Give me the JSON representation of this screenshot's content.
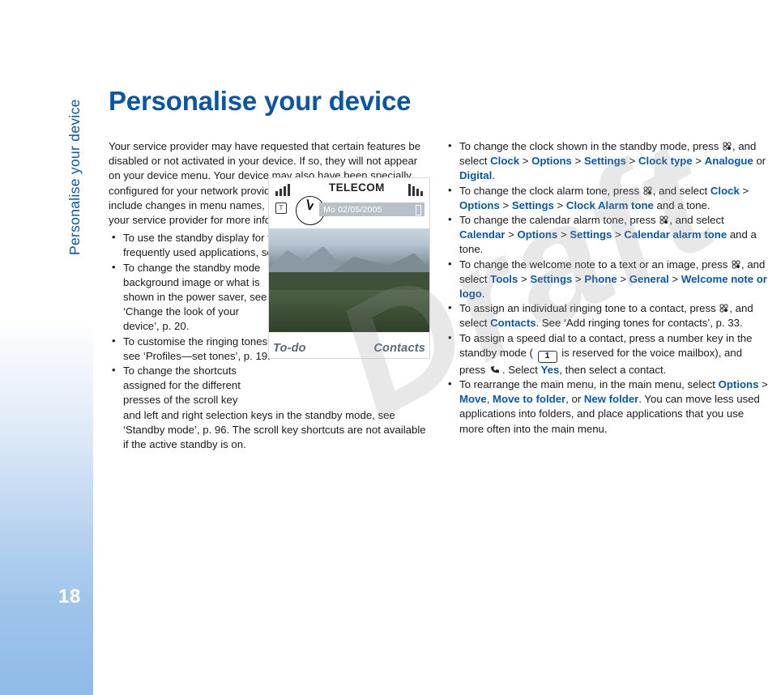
{
  "sidebar": {
    "running_head": "Personalise your device",
    "page_number": "18"
  },
  "page": {
    "title": "Personalise your device",
    "watermark": "Draft"
  },
  "left_column": {
    "intro": "Your service provider may have requested that certain features be disabled or not activated in your device. If so, they will not appear on your device menu. Your device may also have been specially configured for your network provider. This configuration may include changes in menu names, menu order, and icons. Contact your service provider for more information.",
    "bullets": [
      "To use the standby display for fast access to your most frequently used applications, see ‘Active standby mode’, p. 21.",
      "To change the standby mode background image or what is shown in the power saver, see ‘Change the look of your device’, p. 20.",
      "To customise the ringing tones, see ‘Profiles—set tones’, p. 19.",
      "To change the shortcuts assigned for the different presses of the scroll key and left and right selection keys in the standby mode, see ‘Standby mode’, p. 96. The scroll key shortcuts are not available if the active standby is on."
    ]
  },
  "phone_figure": {
    "operator": "TELECOM",
    "date": "Mo 02/05/2005",
    "softkey_left": "To-do",
    "softkey_right": "Contacts"
  },
  "right_column": {
    "bullets": [
      {
        "parts": [
          {
            "t": "To change the clock shown in the standby mode, press ",
            "s": "plain"
          },
          {
            "t": "menu-icon",
            "s": "icon"
          },
          {
            "t": ", and select ",
            "s": "plain"
          },
          {
            "t": "Clock",
            "s": "blue"
          },
          {
            "t": " > ",
            "s": "plain"
          },
          {
            "t": "Options",
            "s": "blue"
          },
          {
            "t": " > ",
            "s": "plain"
          },
          {
            "t": "Settings",
            "s": "blue"
          },
          {
            "t": " > ",
            "s": "plain"
          },
          {
            "t": "Clock type",
            "s": "blue"
          },
          {
            "t": " > ",
            "s": "plain"
          },
          {
            "t": "Analogue",
            "s": "blue"
          },
          {
            "t": " or ",
            "s": "plain"
          },
          {
            "t": "Digital",
            "s": "blue"
          },
          {
            "t": ".",
            "s": "plain"
          }
        ]
      },
      {
        "parts": [
          {
            "t": "To change the clock alarm tone, press ",
            "s": "plain"
          },
          {
            "t": "menu-icon",
            "s": "icon"
          },
          {
            "t": ", and select ",
            "s": "plain"
          },
          {
            "t": "Clock",
            "s": "blue"
          },
          {
            "t": " > ",
            "s": "plain"
          },
          {
            "t": "Options",
            "s": "blue"
          },
          {
            "t": " > ",
            "s": "plain"
          },
          {
            "t": "Settings",
            "s": "blue"
          },
          {
            "t": " > ",
            "s": "plain"
          },
          {
            "t": "Clock Alarm tone",
            "s": "blue"
          },
          {
            "t": " and a tone.",
            "s": "plain"
          }
        ]
      },
      {
        "parts": [
          {
            "t": "To change the calendar alarm tone, press ",
            "s": "plain"
          },
          {
            "t": "menu-icon",
            "s": "icon"
          },
          {
            "t": ", and select ",
            "s": "plain"
          },
          {
            "t": "Calendar",
            "s": "blue"
          },
          {
            "t": " > ",
            "s": "plain"
          },
          {
            "t": "Options",
            "s": "blue"
          },
          {
            "t": " > ",
            "s": "plain"
          },
          {
            "t": "Settings",
            "s": "blue"
          },
          {
            "t": " > ",
            "s": "plain"
          },
          {
            "t": "Calendar alarm tone",
            "s": "blue"
          },
          {
            "t": " and a tone.",
            "s": "plain"
          }
        ]
      },
      {
        "parts": [
          {
            "t": "To change the welcome note to a text or an image, press ",
            "s": "plain"
          },
          {
            "t": "menu-icon",
            "s": "icon"
          },
          {
            "t": ", and select ",
            "s": "plain"
          },
          {
            "t": "Tools",
            "s": "blue"
          },
          {
            "t": " > ",
            "s": "plain"
          },
          {
            "t": "Settings",
            "s": "blue"
          },
          {
            "t": " > ",
            "s": "plain"
          },
          {
            "t": "Phone",
            "s": "blue"
          },
          {
            "t": " > ",
            "s": "plain"
          },
          {
            "t": "General",
            "s": "blue"
          },
          {
            "t": " > ",
            "s": "plain"
          },
          {
            "t": "Welcome note or logo",
            "s": "blue"
          },
          {
            "t": ".",
            "s": "plain"
          }
        ]
      },
      {
        "parts": [
          {
            "t": "To assign an individual ringing tone to a contact, press ",
            "s": "plain"
          },
          {
            "t": "menu-icon",
            "s": "icon"
          },
          {
            "t": ", and select ",
            "s": "plain"
          },
          {
            "t": "Contacts",
            "s": "blue"
          },
          {
            "t": ". See ‘Add ringing tones for contacts’, p. 33.",
            "s": "plain"
          }
        ]
      },
      {
        "parts": [
          {
            "t": "To assign a speed dial to a contact, press a number key in the standby mode ( ",
            "s": "plain"
          },
          {
            "t": "key-1-icon",
            "s": "key"
          },
          {
            "t": " is reserved for the voice mailbox), and press ",
            "s": "plain"
          },
          {
            "t": "call-key-icon",
            "s": "callkey"
          },
          {
            "t": ". Select ",
            "s": "plain"
          },
          {
            "t": "Yes",
            "s": "blue"
          },
          {
            "t": ", then select a contact.",
            "s": "plain"
          }
        ]
      },
      {
        "parts": [
          {
            "t": "To rearrange the main menu, in the main menu, select ",
            "s": "plain"
          },
          {
            "t": "Options",
            "s": "blue"
          },
          {
            "t": " > ",
            "s": "plain"
          },
          {
            "t": "Move",
            "s": "blue"
          },
          {
            "t": ", ",
            "s": "plain"
          },
          {
            "t": "Move to folder",
            "s": "blue"
          },
          {
            "t": ", or ",
            "s": "plain"
          },
          {
            "t": "New folder",
            "s": "blue"
          },
          {
            "t": ". You can move less used applications into folders, and place applications that you use more often into the main menu.",
            "s": "plain"
          }
        ]
      }
    ],
    "key_1_label": "1"
  },
  "colors": {
    "accent_blue": "#0b56a4",
    "sidebar_gradient_end": "#8fbbe7"
  }
}
